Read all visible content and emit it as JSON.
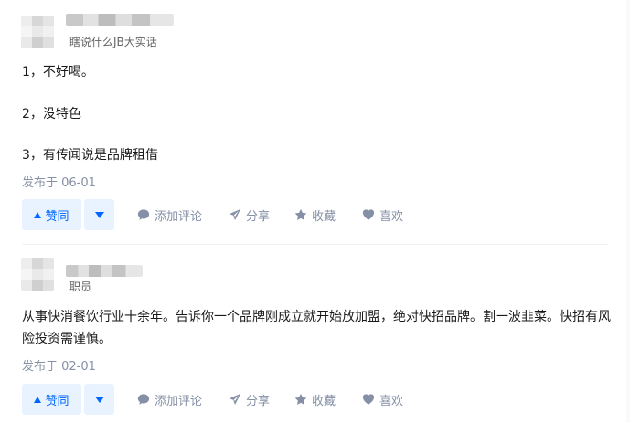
{
  "answers": [
    {
      "author_headline": "瞎说什么JB大实话",
      "paragraphs": [
        "1，不好喝。",
        "2，没特色",
        "3，有传闻说是品牌租借"
      ],
      "date": "发布于 06-01",
      "actions": {
        "vote_up": "赞同",
        "comment": "添加评论",
        "share": "分享",
        "collect": "收藏",
        "like": "喜欢"
      }
    },
    {
      "author_headline": "职员",
      "paragraphs": [
        "从事快消餐饮行业十余年。告诉你一个品牌刚成立就开始放加盟，绝对快招品牌。割一波韭菜。快招有风险投资需谨慎。"
      ],
      "date": "发布于 02-01",
      "actions": {
        "vote_up": "赞同",
        "comment": "添加评论",
        "share": "分享",
        "collect": "收藏",
        "like": "喜欢"
      }
    }
  ],
  "icons": {
    "vote_up": "triangle-up-icon",
    "vote_down": "triangle-down-icon",
    "comment": "comment-bubble-icon",
    "share": "paper-plane-icon",
    "collect": "star-icon",
    "like": "heart-icon"
  },
  "colors": {
    "accent": "#0066ff",
    "vote_bg": "#e8f3ff",
    "meta_text": "#8590a6"
  }
}
